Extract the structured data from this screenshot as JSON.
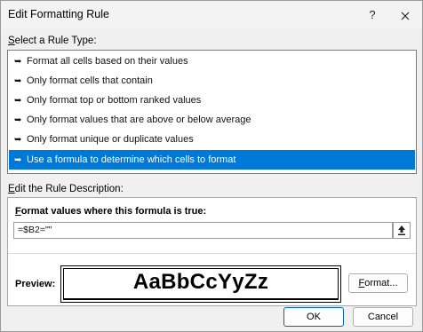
{
  "window": {
    "title": "Edit Formatting Rule",
    "help_label": "?",
    "close_label": "✕"
  },
  "rule_type": {
    "label_prefix": "S",
    "label_rest": "elect a Rule Type:",
    "items": [
      {
        "label": "Format all cells based on their values",
        "selected": false
      },
      {
        "label": "Only format cells that contain",
        "selected": false
      },
      {
        "label": "Only format top or bottom ranked values",
        "selected": false
      },
      {
        "label": "Only format values that are above or below average",
        "selected": false
      },
      {
        "label": "Only format unique or duplicate values",
        "selected": false
      },
      {
        "label": "Use a formula to determine which cells to format",
        "selected": true
      }
    ],
    "item_icon": "arrow-right-icon",
    "item_glyph": "➥"
  },
  "description": {
    "label_prefix": "E",
    "label_rest": "dit the Rule Description:",
    "formula_label_prefix": "F",
    "formula_label_rest": "ormat values where this formula is true:",
    "formula_value": "=$B2=\"\"",
    "preview_label": "Preview:",
    "preview_sample": "AaBbCcYyZz",
    "format_button_prefix": "F",
    "format_button_rest": "ormat..."
  },
  "buttons": {
    "ok": "OK",
    "cancel": "Cancel"
  },
  "colors": {
    "selection": "#0078d7",
    "background": "#f0f0f0"
  }
}
